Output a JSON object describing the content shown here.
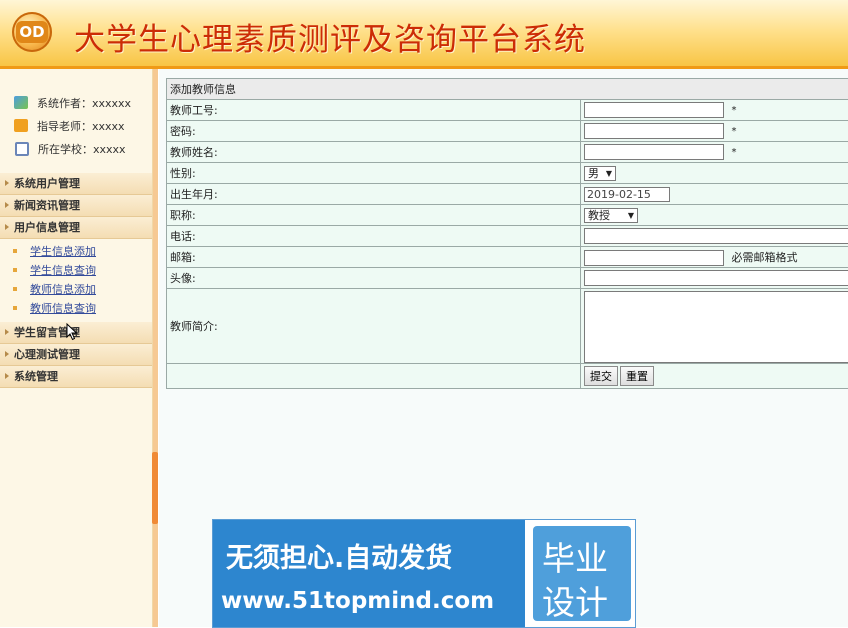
{
  "header": {
    "logo_text": "OD",
    "title": "大学生心理素质测评及咨询平台系统"
  },
  "sidebar": {
    "info": [
      {
        "icon": "users-icon",
        "label": "系统作者：xxxxxx"
      },
      {
        "icon": "teacher-icon",
        "label": "指导老师：xxxxx"
      },
      {
        "icon": "school-icon",
        "label": "所在学校：xxxxx"
      }
    ],
    "menu": {
      "system_users": "系统用户管理",
      "news": "新闻资讯管理",
      "user_info": "用户信息管理",
      "user_info_items": [
        "学生信息添加",
        "学生信息查询",
        "教师信息添加",
        "教师信息查询"
      ],
      "messages": "学生留言管理",
      "psych_test": "心理测试管理",
      "system": "系统管理"
    }
  },
  "form": {
    "caption": "添加教师信息",
    "labels": {
      "teacher_id": "教师工号:",
      "password": "密码:",
      "teacher_name": "教师姓名:",
      "gender": "性别:",
      "birth_date": "出生年月:",
      "title": "职称:",
      "phone": "电话:",
      "email": "邮箱:",
      "avatar": "头像:",
      "intro": "教师简介:"
    },
    "required_mark": "*",
    "gender_value": "男",
    "birth_date_value": "2019-02-15",
    "title_value": "教授",
    "email_hint": "必需邮箱格式",
    "submit_label": "提交",
    "reset_label": "重置"
  },
  "watermark": {
    "line1": "无须担心.自动发货",
    "line2": "www.51topmind.com",
    "right1": "毕业",
    "right2": "设计"
  }
}
